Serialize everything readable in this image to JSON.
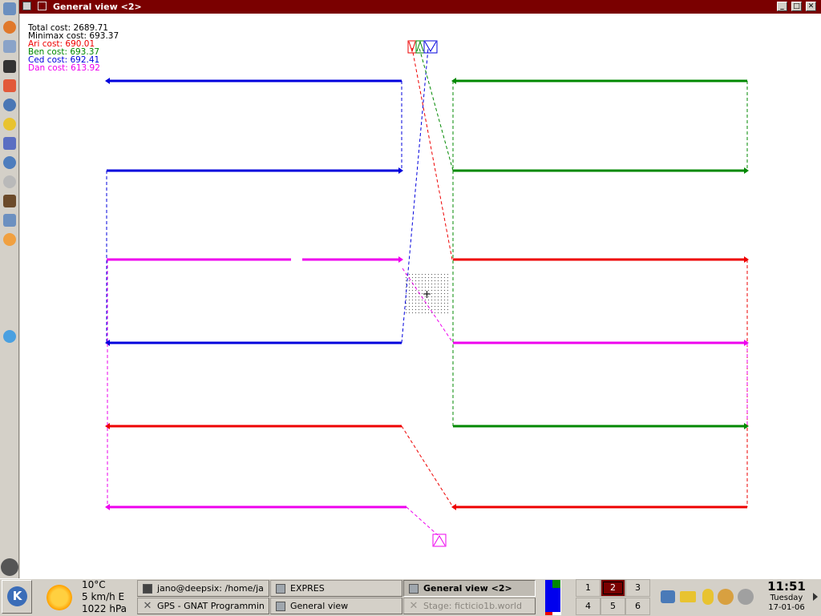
{
  "window": {
    "title": "General view <2>"
  },
  "costs": {
    "total": "Total cost: 2689.71",
    "minimax": "Minimax cost: 693.37",
    "ari": "Ari cost: 690.01",
    "ben": "Ben cost: 693.37",
    "ced": "Ced cost: 692.41",
    "dan": "Dan cost: 613.92"
  },
  "colors": {
    "ari": "#ee0000",
    "ben": "#008800",
    "ced": "#0000dd",
    "dan": "#ee00ee",
    "titlebar": "#7a0000"
  },
  "weather": {
    "temp": "10°C",
    "wind": "5 km/h E",
    "pressure": "1022 hPa"
  },
  "tasks": [
    {
      "label": "jano@deepsix: /home/ja",
      "icon": "terminal-icon"
    },
    {
      "label": "EXPRES",
      "icon": "window-icon"
    },
    {
      "label": "General view <2>",
      "icon": "window-icon"
    },
    {
      "label": "GPS - GNAT Programmin",
      "icon": "x-icon"
    },
    {
      "label": "General view",
      "icon": "window-icon"
    },
    {
      "label": "Stage: ficticio1b.world",
      "icon": "x-icon"
    }
  ],
  "pager": [
    "1",
    "2",
    "3",
    "4",
    "5",
    "6"
  ],
  "clock": {
    "time": "11:51",
    "day": "Tuesday",
    "date": "17-01-06"
  }
}
